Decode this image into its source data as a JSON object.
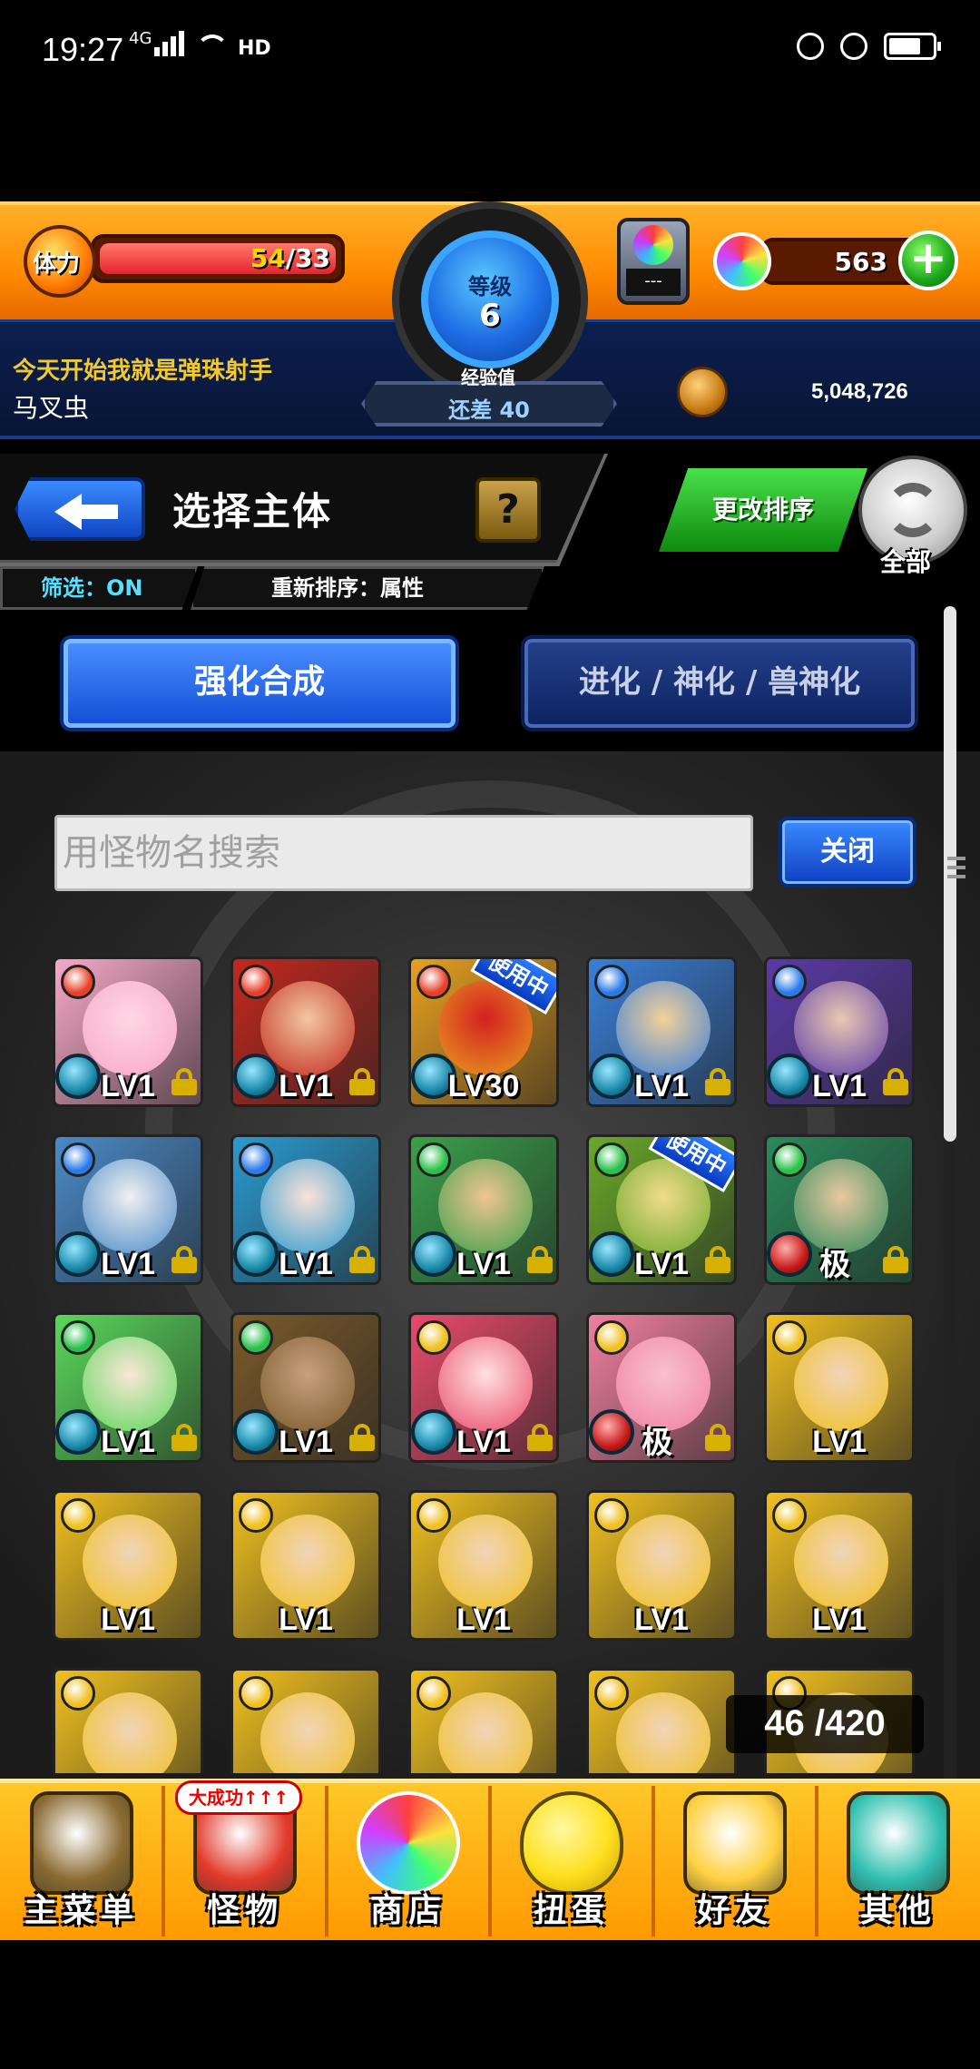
{
  "statusbar": {
    "time": "19:27",
    "network": "4G"
  },
  "header": {
    "stamina_label": "体力",
    "stamina_current": "54",
    "stamina_max": "/33",
    "stamina_fill": 1.0,
    "level_label": "等级",
    "level_value": "6",
    "exp_label": "经验值",
    "exp_value": "还差 40",
    "gacha_text": "---",
    "orb_count": "563",
    "motto": "今天开始我就是弹珠射手",
    "player_name": "马叉虫",
    "gold": "5,048,726"
  },
  "title_bar": {
    "title": "选择主体",
    "help": "?",
    "filter": "筛选：ON",
    "sort": "重新排序：属性",
    "change_sort": "更改排序",
    "refresh_label": "全部"
  },
  "tabs": {
    "enhance": "强化合成",
    "evolve": "进化 / 神化 / 兽神化"
  },
  "search": {
    "placeholder": "用怪物名搜索",
    "close": "关闭"
  },
  "count": "46 /420",
  "monsters": [
    {
      "lv": "LV1",
      "attr": "fire",
      "locked": true,
      "bg": "#f7a8c8",
      "face": "#ffd6e4"
    },
    {
      "lv": "LV1",
      "attr": "fire",
      "locked": true,
      "bg": "#c2281e",
      "face": "#f2c7a0"
    },
    {
      "lv": "LV30",
      "attr": "fire",
      "locked": false,
      "bg": "#e8a020",
      "face": "#d42020",
      "badge": "使用中"
    },
    {
      "lv": "LV1",
      "attr": "water",
      "locked": true,
      "bg": "#3a7fd8",
      "face": "#f2d19a"
    },
    {
      "lv": "LV1",
      "attr": "water",
      "locked": true,
      "bg": "#5a3aa8",
      "face": "#e9c9b2"
    },
    {
      "lv": "LV1",
      "attr": "water",
      "locked": true,
      "bg": "#4a8ac8",
      "face": "#f0f0f0"
    },
    {
      "lv": "LV1",
      "attr": "water",
      "locked": true,
      "bg": "#2a9ad0",
      "face": "#fbe2d8"
    },
    {
      "lv": "LV1",
      "attr": "wood",
      "locked": true,
      "bg": "#3aa04a",
      "face": "#f0c490"
    },
    {
      "lv": "LV1",
      "attr": "wood",
      "locked": true,
      "bg": "#6aa82a",
      "face": "#f2dc8a",
      "badge": "使用中"
    },
    {
      "lv": "极",
      "attr": "wood",
      "locked": true,
      "bg": "#2a8a5a",
      "face": "#e8c8a0",
      "maxed": true
    },
    {
      "lv": "LV1",
      "attr": "wood",
      "locked": true,
      "bg": "#5ad85a",
      "face": "#fbe6d8"
    },
    {
      "lv": "LV1",
      "attr": "wood",
      "locked": true,
      "bg": "#7a5a2a",
      "face": "#c8a080"
    },
    {
      "lv": "LV1",
      "attr": "light",
      "locked": true,
      "bg": "#e84a6a",
      "face": "#ffe0e0"
    },
    {
      "lv": "极",
      "attr": "light",
      "locked": true,
      "bg": "#f080a0",
      "face": "#f8c0d0",
      "maxed": true
    },
    {
      "lv": "LV1",
      "attr": "light",
      "locked": false,
      "bg": "#f0c020",
      "face": "#f2d4b8"
    },
    {
      "lv": "LV1",
      "attr": "light",
      "locked": false,
      "bg": "#f0c020",
      "face": "#f2d4b8"
    },
    {
      "lv": "LV1",
      "attr": "light",
      "locked": false,
      "bg": "#f0c020",
      "face": "#f2d4b8"
    },
    {
      "lv": "LV1",
      "attr": "light",
      "locked": false,
      "bg": "#f0c020",
      "face": "#f2d4b8"
    },
    {
      "lv": "LV1",
      "attr": "light",
      "locked": false,
      "bg": "#f0c020",
      "face": "#f2d4b8"
    },
    {
      "lv": "LV1",
      "attr": "light",
      "locked": false,
      "bg": "#f0c020",
      "face": "#f2d4b8"
    },
    {
      "lv": "",
      "attr": "light",
      "locked": false,
      "bg": "#f0c020",
      "face": "#f2d4b8"
    },
    {
      "lv": "",
      "attr": "light",
      "locked": false,
      "bg": "#f0c020",
      "face": "#f2d4b8"
    },
    {
      "lv": "",
      "attr": "light",
      "locked": false,
      "bg": "#f0c020",
      "face": "#f2d4b8"
    },
    {
      "lv": "",
      "attr": "light",
      "locked": false,
      "bg": "#f0c020",
      "face": "#f2d4b8"
    },
    {
      "lv": "",
      "attr": "light",
      "locked": false,
      "bg": "#f0c020",
      "face": "#f2d4b8"
    }
  ],
  "attr_colors": {
    "fire": "#e8402a",
    "water": "#2a7ae8",
    "wood": "#2ac04a",
    "light": "#f0c020"
  },
  "bottom_nav": [
    {
      "label": "主菜单",
      "icon": "gate-icon",
      "color": "#8a6a30"
    },
    {
      "label": "怪物",
      "icon": "monster-icon",
      "color": "#e23a2a",
      "badge": "大成功↑↑↑"
    },
    {
      "label": "商店",
      "icon": "rainbow-orb-icon",
      "color": "#40c0ff"
    },
    {
      "label": "扭蛋",
      "icon": "egg-icon",
      "color": "#ffe020"
    },
    {
      "label": "好友",
      "icon": "friends-icon",
      "color": "#ffd040"
    },
    {
      "label": "其他",
      "icon": "other-icon",
      "color": "#30c0b0"
    }
  ]
}
